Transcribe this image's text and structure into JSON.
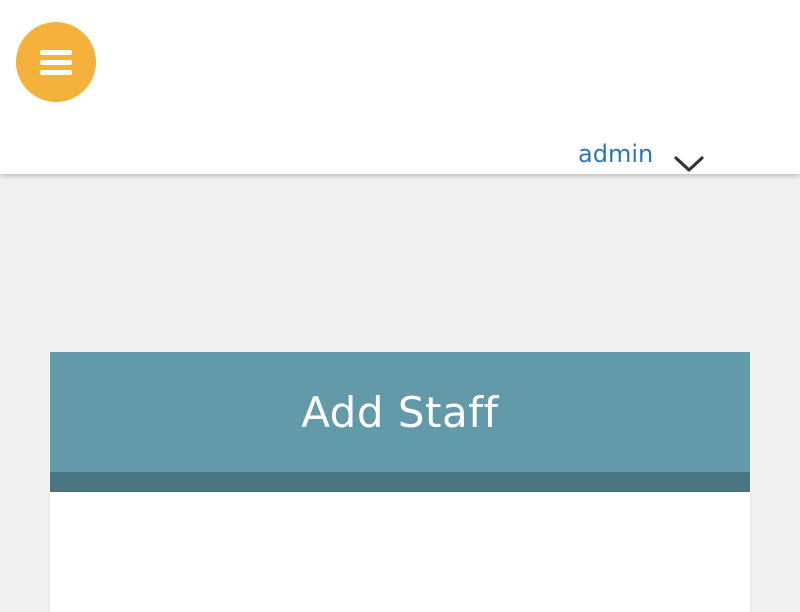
{
  "header": {
    "menu_icon": "hamburger-menu-icon",
    "user": {
      "name": "admin",
      "chevron_icon": "chevron-down-icon"
    }
  },
  "card": {
    "title": "Add Staff"
  },
  "colors": {
    "menu_button": "#f4b13c",
    "user_link": "#2e77b3",
    "card_header": "#639aa9",
    "card_strip": "#4a7582",
    "page_background": "#f1f1f1"
  }
}
